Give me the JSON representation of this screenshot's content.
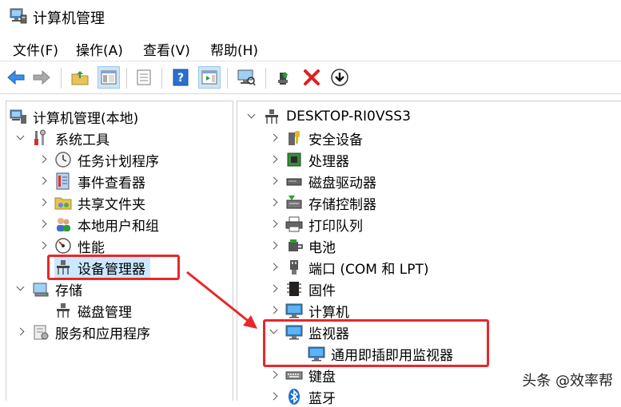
{
  "window": {
    "title": "计算机管理"
  },
  "menu": [
    {
      "label": "文件",
      "key": "(F)"
    },
    {
      "label": "操作",
      "key": "(A)"
    },
    {
      "label": "查看",
      "key": "(V)"
    },
    {
      "label": "帮助",
      "key": "(H)"
    }
  ],
  "left_tree": {
    "root": "计算机管理(本地)",
    "system_tools": "系统工具",
    "task_scheduler": "任务计划程序",
    "event_viewer": "事件查看器",
    "shared_folders": "共享文件夹",
    "local_users": "本地用户和组",
    "performance": "性能",
    "device_manager": "设备管理器",
    "storage": "存储",
    "disk_management": "磁盘管理",
    "services_apps": "服务和应用程序"
  },
  "right_tree": {
    "computer_name": "DESKTOP-RI0VSS3",
    "items": {
      "security_devices": "安全设备",
      "processors": "处理器",
      "disk_drives": "磁盘驱动器",
      "storage_controllers": "存储控制器",
      "print_queues": "打印队列",
      "batteries": "电池",
      "ports": "端口 (COM 和 LPT)",
      "firmware": "固件",
      "computer": "计算机",
      "monitors": "监视器",
      "generic_monitor": "通用即插即用监视器",
      "keyboards": "键盘",
      "bluetooth": "蓝牙"
    }
  },
  "watermark": "头条 @效率帮",
  "colors": {
    "highlight": "#e8272a",
    "selection": "#cce8ff",
    "accent": "#1e7fd6"
  }
}
